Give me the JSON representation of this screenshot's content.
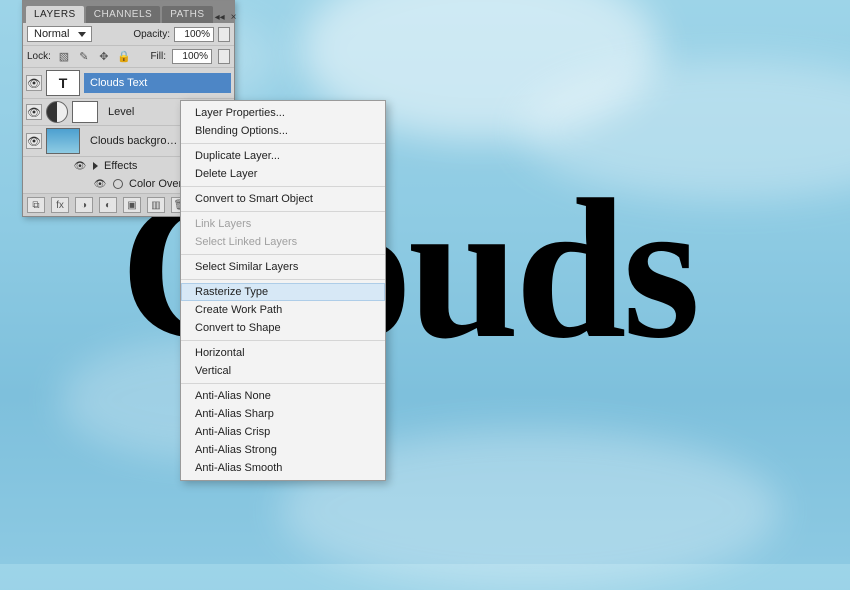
{
  "canvas_text": "Clouds",
  "panel": {
    "tabs": [
      "LAYERS",
      "CHANNELS",
      "PATHS"
    ],
    "active_tab_index": 0,
    "blend_mode": "Normal",
    "opacity_label": "Opacity:",
    "opacity_value": "100%",
    "lock_label": "Lock:",
    "fill_label": "Fill:",
    "fill_value": "100%",
    "layers": [
      {
        "name": "Clouds Text",
        "selected": true,
        "type": "text"
      },
      {
        "name": "Level",
        "selected": false,
        "type": "adjustment"
      },
      {
        "name": "Clouds backgro…",
        "selected": false,
        "type": "image"
      }
    ],
    "effects_label": "Effects",
    "effect_item": "Color Overla…"
  },
  "menu": {
    "groups": [
      [
        "Layer Properties...",
        "Blending Options..."
      ],
      [
        "Duplicate Layer...",
        "Delete Layer"
      ],
      [
        "Convert to Smart Object"
      ],
      [
        "Link Layers",
        "Select Linked Layers"
      ],
      [
        "Select Similar Layers"
      ],
      [
        "Rasterize Type",
        "Create Work Path",
        "Convert to Shape"
      ],
      [
        "Horizontal",
        "Vertical"
      ],
      [
        "Anti-Alias None",
        "Anti-Alias Sharp",
        "Anti-Alias Crisp",
        "Anti-Alias Strong",
        "Anti-Alias Smooth"
      ]
    ],
    "disabled": [
      "Link Layers",
      "Select Linked Layers"
    ],
    "highlighted": "Rasterize Type"
  }
}
